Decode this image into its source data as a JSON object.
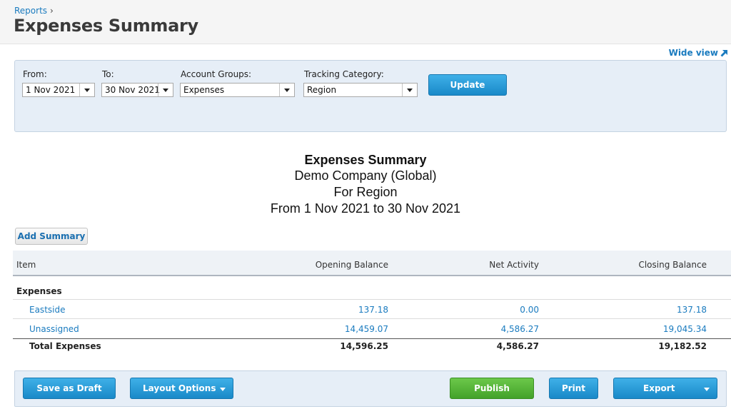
{
  "header": {
    "breadcrumb": "Reports",
    "breadcrumb_separator": "›",
    "title": "Expenses Summary",
    "wide_view": "Wide view"
  },
  "filters": {
    "from_label": "From:",
    "from_value": "1 Nov 2021",
    "to_label": "To:",
    "to_value": "30 Nov 2021",
    "account_groups_label": "Account Groups:",
    "account_groups_value": "Expenses",
    "tracking_label": "Tracking Category:",
    "tracking_value": "Region",
    "update_label": "Update"
  },
  "report": {
    "title": "Expenses Summary",
    "company": "Demo Company (Global)",
    "for_line": "For Region",
    "period": "From 1 Nov 2021 to 30 Nov 2021",
    "add_summary_label": "Add Summary",
    "columns": {
      "item": "Item",
      "opening": "Opening Balance",
      "net": "Net Activity",
      "closing": "Closing Balance"
    },
    "section": "Expenses",
    "rows": [
      {
        "item": "Eastside",
        "opening": "137.18",
        "net": "0.00",
        "closing": "137.18"
      },
      {
        "item": "Unassigned",
        "opening": "14,459.07",
        "net": "4,586.27",
        "closing": "19,045.34"
      }
    ],
    "total": {
      "item": "Total Expenses",
      "opening": "14,596.25",
      "net": "4,586.27",
      "closing": "19,182.52"
    }
  },
  "footer": {
    "save_draft": "Save as Draft",
    "layout_options": "Layout Options",
    "publish": "Publish",
    "print": "Print",
    "export": "Export"
  },
  "colors": {
    "accent_blue": "#1989c8",
    "link_blue": "#1a7bbf",
    "publish_green": "#43a22a",
    "panel_bg": "#e6eef7"
  }
}
